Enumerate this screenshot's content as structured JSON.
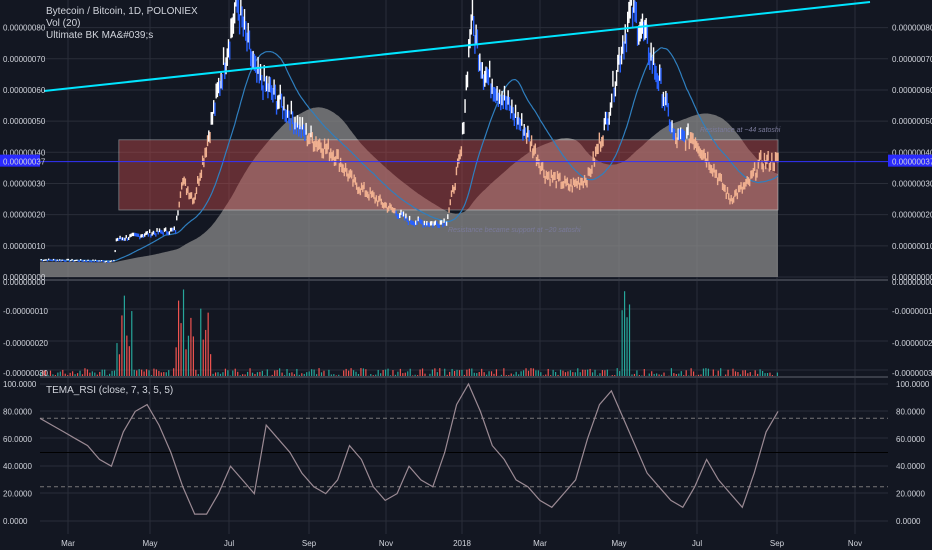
{
  "header": {
    "symbol_line": "Bytecoin / Bitcoin, 1D, POLONIEX",
    "vol_line": "Vol (20)",
    "ma_line": "Ultimate BK MA&#039;s"
  },
  "colors": {
    "background": "#131722",
    "grid": "#2a2e39",
    "price_up": "#ffffff",
    "price_down": "#2962ff",
    "price_flat": "#f0b090",
    "trendline": "#00e5ff",
    "ma": "#2f7fbf",
    "box_fill": "#c24b4b",
    "box_border": "#ffffff",
    "area_fill": "#8a8a8a",
    "vol_up": "#26a69a",
    "vol_down": "#ef5350",
    "rsi_line": "#9b8a94",
    "crosshair": "#3333ff"
  },
  "chart_data": [
    {
      "type": "line",
      "panel": "price",
      "y_labels": [
        "0.00000080",
        "0.00000070",
        "0.00000060",
        "0.00000050",
        "0.00000040",
        "0.00000037",
        "0.00000030",
        "0.00000020",
        "0.00000010",
        "0.00000000"
      ],
      "current_price_label": "0.00000037",
      "ylim": [
        0,
        8.5e-07
      ],
      "annotations": [
        "Resistance became support at ~20 satoshi",
        "Resistance at ~44 satoshi"
      ],
      "price_series_approx": [
        [
          "Feb",
          5.5e-08
        ],
        [
          "Mar",
          5e-08
        ],
        [
          "Apr",
          1.3e-07
        ],
        [
          "May",
          3e-07
        ],
        [
          "Jun",
          8e-07
        ],
        [
          "Jul",
          6e-07
        ],
        [
          "Aug",
          4.5e-07
        ],
        [
          "Sep",
          3.8e-07
        ],
        [
          "Oct",
          3e-07
        ],
        [
          "Nov",
          1.7e-07
        ],
        [
          "Dec",
          1.8e-07
        ],
        [
          "2018",
          7.8e-07
        ],
        [
          "Feb",
          4.5e-07
        ],
        [
          "Mar",
          3e-07
        ],
        [
          "Apr",
          3.2e-07
        ],
        [
          "May",
          7e-07
        ],
        [
          "Jun",
          7.5e-07
        ],
        [
          "Jul",
          4.5e-07
        ],
        [
          "Aug",
          3.8e-07
        ],
        [
          "Sep",
          3.7e-07
        ]
      ]
    },
    {
      "type": "bar",
      "panel": "volume",
      "y_labels": [
        "0.00000000",
        "-0.00000010",
        "-0.00000020",
        "-0.00000030"
      ]
    },
    {
      "type": "line",
      "panel": "rsi",
      "title": "TEMA_RSI (close, 7, 3, 5, 5)",
      "y_labels": [
        "100.0000",
        "80.0000",
        "60.0000",
        "40.0000",
        "20.0000",
        "0.0000"
      ],
      "right_labels": [
        "100.0000",
        "80.0000",
        "60.0000",
        "40.0000",
        "20.0000",
        "0.0000"
      ],
      "ylim": [
        0,
        100
      ],
      "levels": [
        75,
        50,
        25
      ],
      "values_approx": [
        75,
        70,
        65,
        60,
        55,
        45,
        40,
        65,
        80,
        85,
        70,
        50,
        25,
        5,
        5,
        20,
        40,
        30,
        20,
        70,
        60,
        50,
        35,
        25,
        20,
        30,
        55,
        45,
        25,
        15,
        20,
        40,
        30,
        25,
        50,
        85,
        100,
        80,
        55,
        45,
        30,
        25,
        15,
        10,
        20,
        30,
        60,
        85,
        95,
        75,
        55,
        35,
        25,
        15,
        10,
        25,
        45,
        30,
        20,
        10,
        35,
        65,
        80
      ]
    }
  ],
  "x_axis": {
    "labels": [
      "Mar",
      "May",
      "Jul",
      "Sep",
      "Nov",
      "2018",
      "Mar",
      "May",
      "Jul",
      "Sep",
      "Nov"
    ]
  }
}
